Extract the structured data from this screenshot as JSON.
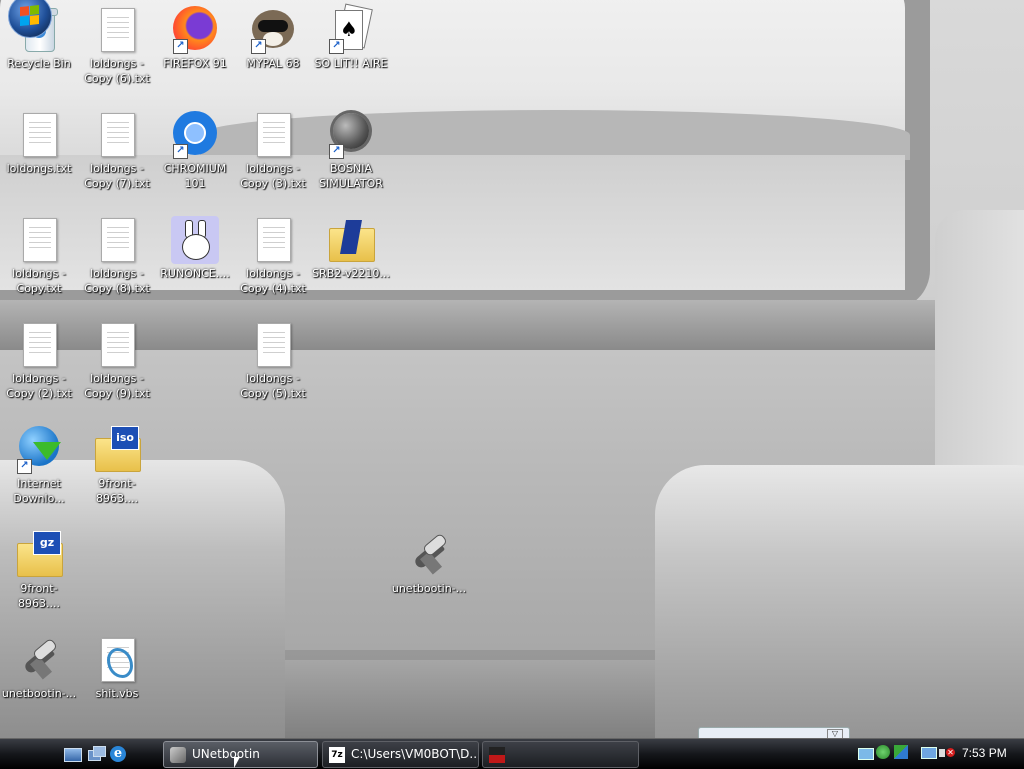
{
  "desktop_icons": [
    {
      "label": "Recycle Bin",
      "kind": "recycle-bin",
      "shortcut": false
    },
    {
      "label": "loldongs - Copy (6).txt",
      "kind": "text-file",
      "shortcut": false
    },
    {
      "label": "FIREFOX 91",
      "kind": "firefox",
      "shortcut": true
    },
    {
      "label": "MYPAL 68",
      "kind": "mypal",
      "shortcut": true
    },
    {
      "label": "SO LIT!! AIRE",
      "kind": "solitaire",
      "shortcut": true
    },
    {
      "label": "loldongs.txt",
      "kind": "text-file",
      "shortcut": false
    },
    {
      "label": "loldongs - Copy (7).txt",
      "kind": "text-file",
      "shortcut": false
    },
    {
      "label": "CHROMIUM 101",
      "kind": "chromium",
      "shortcut": true
    },
    {
      "label": "loldongs - Copy (3).txt",
      "kind": "text-file",
      "shortcut": false
    },
    {
      "label": "BOSNIA SIMULATOR",
      "kind": "minesweeper",
      "shortcut": true
    },
    {
      "label": "loldongs - Copy.txt",
      "kind": "text-file",
      "shortcut": false
    },
    {
      "label": "loldongs - Copy (8).txt",
      "kind": "text-file",
      "shortcut": false
    },
    {
      "label": "RUNONCE....",
      "kind": "bunny",
      "shortcut": false
    },
    {
      "label": "loldongs - Copy (4).txt",
      "kind": "text-file",
      "shortcut": false
    },
    {
      "label": "SRB2-v2210...",
      "kind": "folder",
      "shortcut": false
    },
    {
      "label": "loldongs - Copy (2).txt",
      "kind": "text-file",
      "shortcut": false
    },
    {
      "label": "loldongs - Copy (9).txt",
      "kind": "text-file",
      "shortcut": false
    },
    {
      "label": "loldongs - Copy (5).txt",
      "kind": "text-file",
      "shortcut": false
    },
    {
      "label": "Internet Downlo...",
      "kind": "idm",
      "shortcut": true
    },
    {
      "label": "9front-8963....",
      "kind": "iso-archive",
      "tag": "iso",
      "shortcut": false
    },
    {
      "label": "9front-8963....",
      "kind": "gz-archive",
      "tag": "gz",
      "shortcut": false
    },
    {
      "label": "unetbootin-...",
      "kind": "unetbootin",
      "shortcut": false
    },
    {
      "label": "unetbootin-...",
      "kind": "unetbootin",
      "shortcut": false
    },
    {
      "label": "shit.vbs",
      "kind": "vbs-script",
      "shortcut": false
    }
  ],
  "taskbar": {
    "start_icon": "windows-orb-icon",
    "quick_launch": [
      "show-desktop-icon",
      "switch-windows-icon",
      "internet-explorer-icon"
    ],
    "tasks": [
      {
        "label": "UNetbootin",
        "icon": "unetbootin-icon",
        "active": true
      },
      {
        "label": "C:\\Users\\VM0BOT\\D...",
        "icon": "7zip-icon",
        "active": false
      },
      {
        "label": "",
        "icon": "app-icon",
        "active": false
      }
    ],
    "tray_icons": [
      "network-icon",
      "network-icon-2",
      "update-icon",
      "display-icon",
      "volume-muted-icon"
    ],
    "clock": "7:53 PM"
  },
  "colors": {
    "taskbar": "#15171b",
    "label_text": "#ffffff",
    "folder": "#f3d36a",
    "tag_blue": "#1d4fb5"
  }
}
